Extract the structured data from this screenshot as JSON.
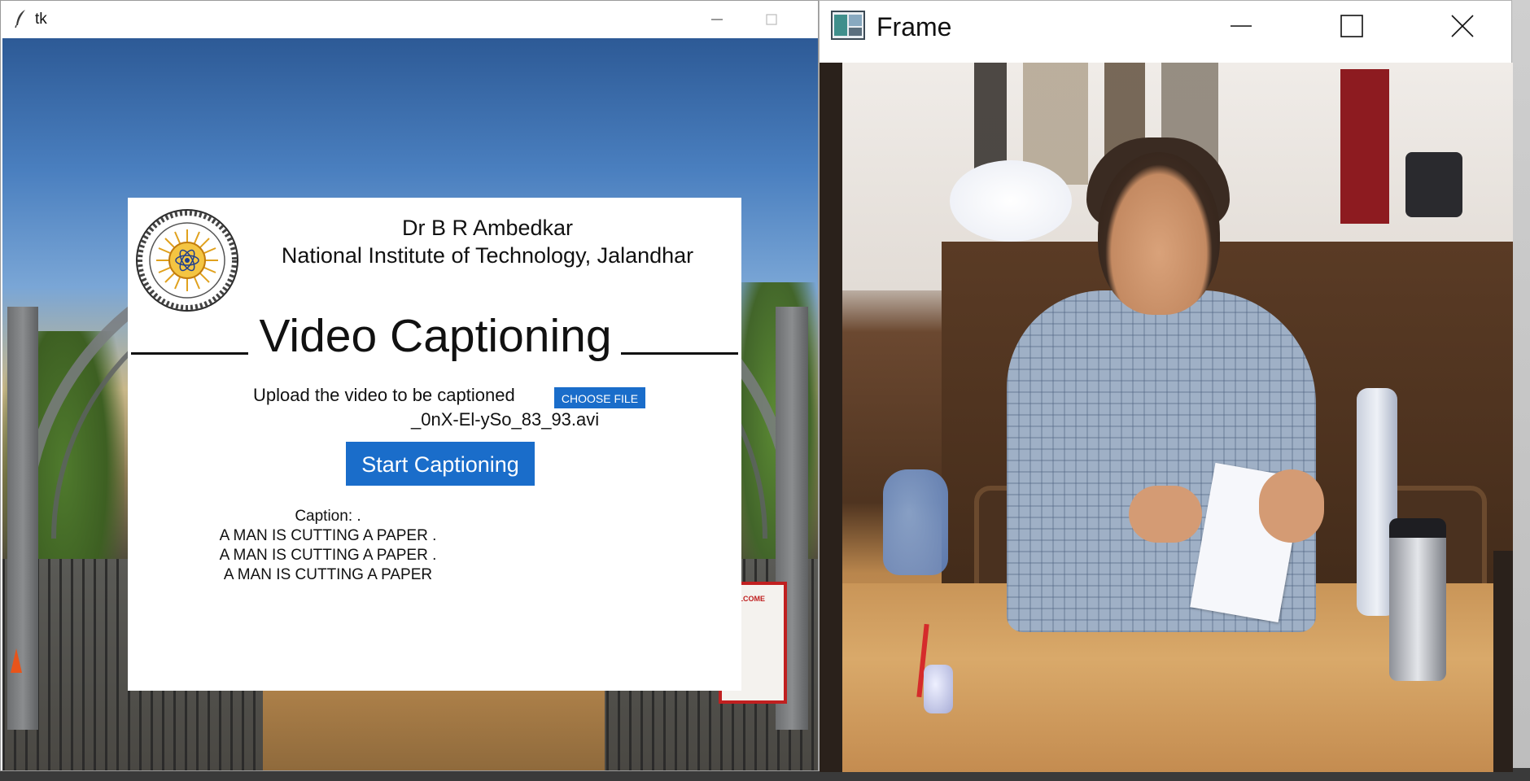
{
  "tk_window": {
    "title": "tk",
    "institute_line1": "Dr B R Ambedkar",
    "institute_line2": "National Institute of Technology, Jalandhar",
    "app_title": "Video Captioning",
    "upload_label": "Upload the video to be captioned",
    "choose_file_label": "CHOOSE FILE",
    "selected_file": "_0nX-El-ySo_83_93.avi",
    "start_button_label": "Start Captioning",
    "caption_lines": [
      "Caption: .",
      "A MAN IS CUTTING A PAPER .",
      "A MAN IS CUTTING A PAPER .",
      "A MAN IS CUTTING A PAPER"
    ],
    "background_sign_text": "WELCOME"
  },
  "frame_window": {
    "title": "Frame"
  },
  "colors": {
    "accent_button": "#1a6dca",
    "title_bar_bg": "#ffffff",
    "panel_bg": "#ffffff"
  },
  "icons": {
    "tk_app_icon": "feather-icon",
    "frame_app_icon": "image-window-icon",
    "minimize": "minimize-icon",
    "maximize": "maximize-icon",
    "close": "close-icon",
    "logo": "institute-logo"
  }
}
